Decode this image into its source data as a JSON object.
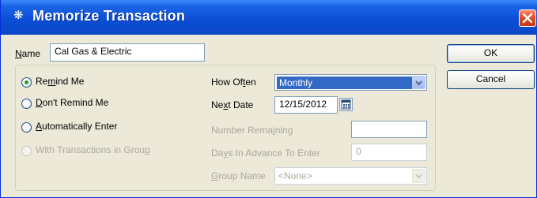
{
  "window": {
    "title": "Memorize Transaction",
    "title_icon": "quickbooks-memorize-icon",
    "close_icon": "close-icon"
  },
  "name_field": {
    "label": "Name",
    "value": "Cal Gas & Electric"
  },
  "buttons": {
    "ok": "OK",
    "cancel": "Cancel"
  },
  "reminder_options": [
    {
      "label": "Remind Me",
      "checked": true,
      "enabled": true
    },
    {
      "label": "Don't Remind Me",
      "checked": false,
      "enabled": true
    },
    {
      "label": "Automatically Enter",
      "checked": false,
      "enabled": true
    },
    {
      "label": "With Transactions in Group",
      "checked": false,
      "enabled": false
    }
  ],
  "how_often": {
    "label": "How Often",
    "value": "Monthly"
  },
  "next_date": {
    "label": "Next Date",
    "value": "12/15/2012",
    "icon": "calendar-icon"
  },
  "number_remaining": {
    "label": "Number Remaining",
    "value": ""
  },
  "days_in_advance": {
    "label": "Days In Advance To Enter",
    "value": "0"
  },
  "group_name": {
    "label": "Group Name",
    "value": "<None>"
  },
  "colors": {
    "titlebar": "#0a4fd6",
    "dialog_bg": "#ece9d8",
    "selection": "#316ac5",
    "close_button": "#e24a22"
  }
}
